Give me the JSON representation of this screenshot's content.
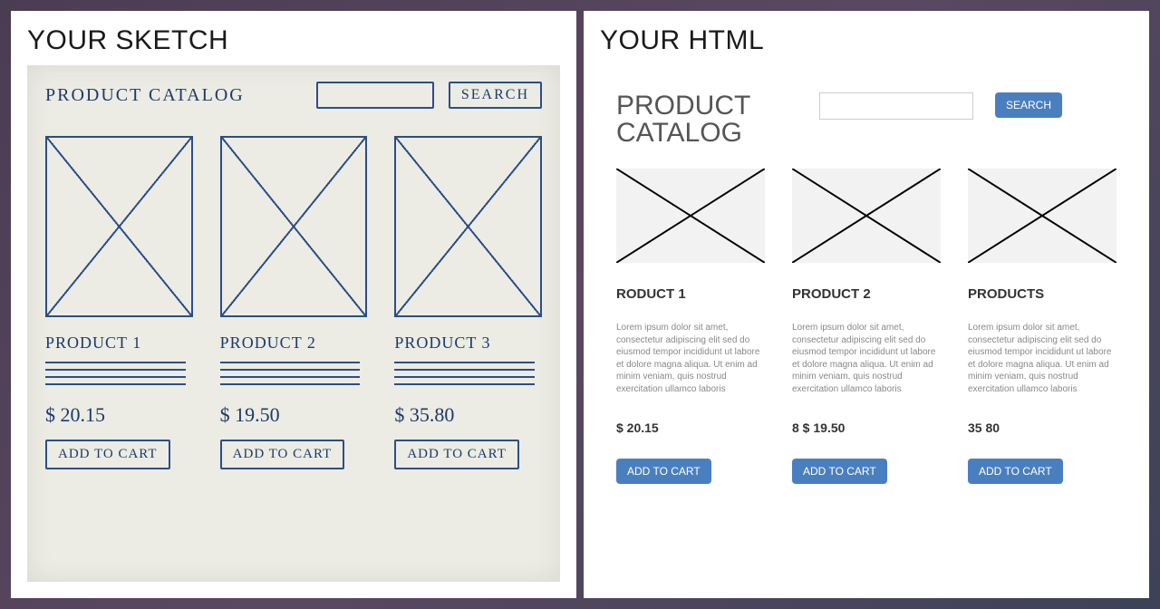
{
  "left": {
    "panel_title": "YOUR SKETCH",
    "heading": "PRODUCT CATALOG",
    "search_label": "SEARCH",
    "products": [
      {
        "name": "PRODUCT 1",
        "price": "$ 20.15",
        "button": "ADD TO CART"
      },
      {
        "name": "PRODUCT 2",
        "price": "$ 19.50",
        "button": "ADD TO CART"
      },
      {
        "name": "PRODUCT 3",
        "price": "$ 35.80",
        "button": "ADD TO CART"
      }
    ]
  },
  "right": {
    "panel_title": "YOUR HTML",
    "heading": "PRODUCT CATALOG",
    "search_label": "SEARCH",
    "search_placeholder": "",
    "description": "Lorem ipsum dolor sit amet, consectetur adipiscing elit sed do eiusmod tempor incididunt ut labore et dolore magna aliqua.\nUt enim ad minim veniam, quis nostrud exercitation ullamco laboris",
    "products": [
      {
        "name": "RODUCT 1",
        "price": "$ 20.15",
        "button": "ADD TO CART"
      },
      {
        "name": "PRODUCT 2",
        "price": "8 $ 19.50",
        "button": "ADD TO CART"
      },
      {
        "name": "PRODUCTS",
        "price": "35 80",
        "button": "ADD TO CART"
      }
    ]
  }
}
